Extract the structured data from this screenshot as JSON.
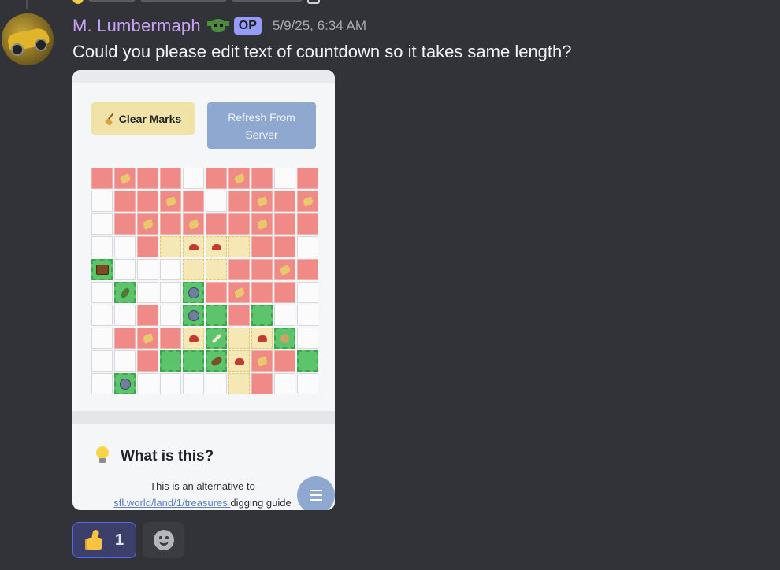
{
  "message": {
    "author": "M. Lumbermaph",
    "badge": "OP",
    "timestamp": "5/9/25, 6:34 AM",
    "text": "Could you please edit text of countdown so it takes same length?"
  },
  "attachment": {
    "clear_button": "Clear Marks",
    "refresh_button": "Refresh From Server",
    "grid": [
      [
        "r",
        "r:sand",
        "r",
        "r",
        "w",
        "r",
        "r:sand",
        "r",
        "w",
        "r"
      ],
      [
        "w",
        "r",
        "r",
        "r:sand",
        "r",
        "w",
        "r",
        "r:sand",
        "r",
        "r:sand"
      ],
      [
        "w",
        "r",
        "r:sand",
        "r",
        "r:sand",
        "r",
        "r",
        "r:sand",
        "r",
        "r"
      ],
      [
        "w",
        "w",
        "r",
        "y",
        "y:crab",
        "y:crab",
        "y",
        "r",
        "r",
        "w"
      ],
      [
        "g:chest",
        "w",
        "w",
        "w",
        "y",
        "y",
        "r",
        "r",
        "r:sand",
        "r"
      ],
      [
        "w",
        "g:pickle",
        "w",
        "w",
        "g:stone",
        "r",
        "r:sand",
        "r",
        "r",
        "w"
      ],
      [
        "w",
        "w",
        "r",
        "w",
        "g:stone",
        "g",
        "r",
        "g",
        "w",
        "w"
      ],
      [
        "w",
        "r",
        "r:sand",
        "r",
        "y:crab",
        "g:bone",
        "y",
        "y:crab",
        "g:sack",
        "w"
      ],
      [
        "w",
        "w",
        "r",
        "g",
        "g",
        "g:log",
        "y:crab",
        "r:sand",
        "r",
        "g"
      ],
      [
        "w",
        "g:stone",
        "w",
        "w",
        "w",
        "w",
        "y",
        "r",
        "w",
        "w"
      ]
    ],
    "info_title": "What is this?",
    "info_line1": "This is an alternative to",
    "info_link": "sfl.world/land/1/treasures ",
    "info_line2": "digging guide"
  },
  "reactions": {
    "thumbs_count": "1"
  }
}
